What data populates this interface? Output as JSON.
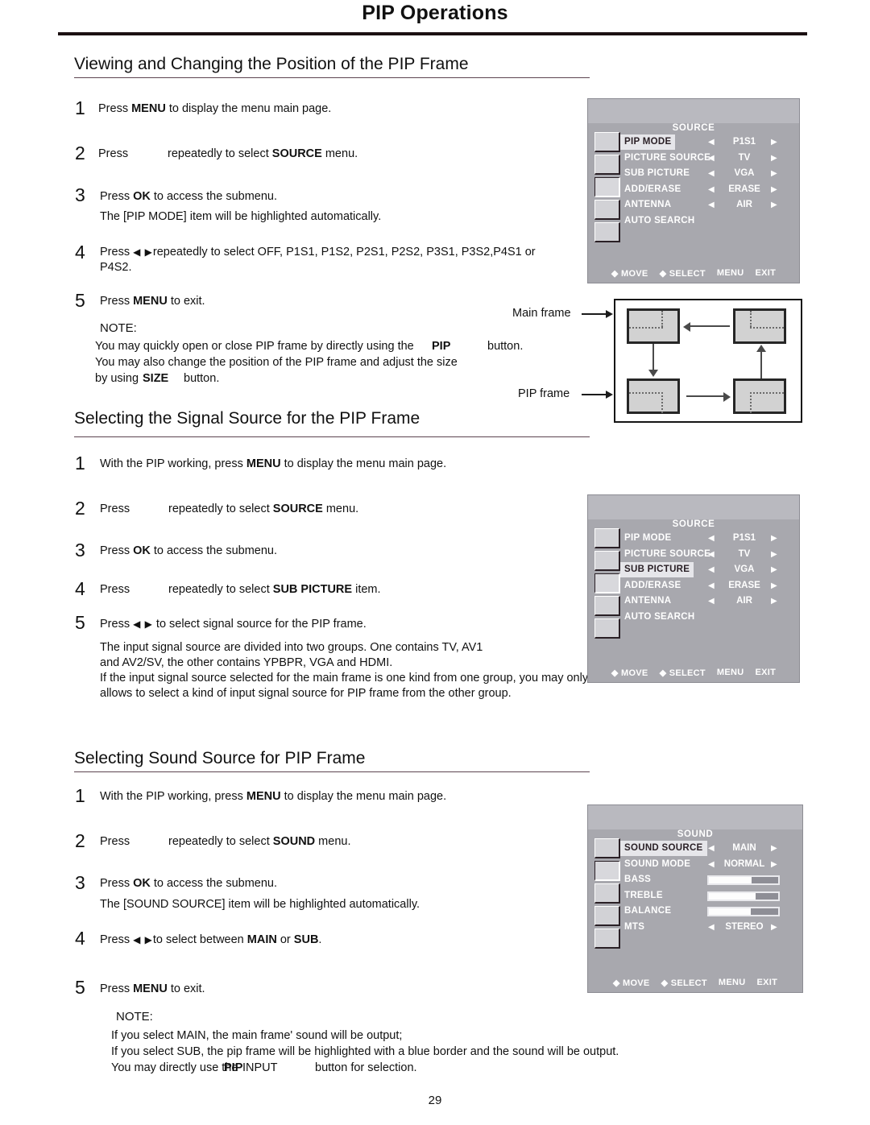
{
  "document": {
    "title": "PIP Operations",
    "page_number": "29"
  },
  "sections": [
    {
      "heading": "Viewing and Changing the Position of the PIP Frame",
      "steps": [
        {
          "n": "1",
          "text_before": "Press ",
          "bold": "MENU",
          "text_after": " to display the menu main page."
        },
        {
          "n": "2",
          "text_before": "Press ",
          "bold": "",
          "text_after": "repeatedly to select ",
          "bold2": "SOURCE",
          "tail": " menu."
        },
        {
          "n": "3",
          "text_before": "Press ",
          "bold": "OK",
          "text_after": " to access the submenu.",
          "sub": "The [PIP MODE] item will be highlighted automatically."
        },
        {
          "n": "4",
          "text_before": "Press ",
          "glyph": "◀ ▶",
          "text_after": "repeatedly to select OFF, P1S1, P1S2, P2S1, P2S2, P3S1, P3S2,P4S1 or",
          "line2": "P4S2."
        },
        {
          "n": "5",
          "text_before": "Press ",
          "bold": "MENU",
          "text_after": " to exit."
        }
      ],
      "note_label": "NOTE:",
      "note_lines": [
        "You may quickly open or close PIP frame by directly using the",
        "PIP",
        "button.",
        "You may also change the position of the PIP frame and adjust the size",
        "by using",
        "SIZE",
        "button."
      ]
    },
    {
      "heading": "Selecting the Signal Source for the PIP Frame",
      "steps": [
        {
          "n": "1",
          "text_before": "With the PIP working, press  ",
          "bold": "MENU",
          "text_after": " to display the menu main page."
        },
        {
          "n": "2",
          "text_before": "Press ",
          "text_after": "repeatedly to select ",
          "bold2": "SOURCE",
          "tail": " menu."
        },
        {
          "n": "3",
          "text_before": "Press ",
          "bold": "OK",
          "text_after": " to access the submenu."
        },
        {
          "n": "4",
          "text_before": "Press ",
          "text_after": "repeatedly to select ",
          "bold2": "SUB PICTURE",
          "tail": " item."
        },
        {
          "n": "5",
          "text_before": "Press ",
          "glyph": "◀  ▶",
          "text_after": " to select signal source for the PIP frame."
        }
      ],
      "body_lines": [
        "The input signal source are divided into two groups. One contains TV, AV1",
        "and AV2/SV, the other contains YPBPR, VGA and HDMI.",
        "If the input signal source selected for the main frame is one kind from one group, you may only",
        "allows to select  a kind of input signal source for PIP frame from the other group."
      ]
    },
    {
      "heading": "Selecting Sound Source for PIP Frame",
      "steps": [
        {
          "n": "1",
          "text_before": "With the PIP working, press  ",
          "bold": "MENU",
          "text_after": " to display the menu main page."
        },
        {
          "n": "2",
          "text_before": "Press ",
          "text_after": "repeatedly to select ",
          "bold2": "SOUND",
          "tail": " menu."
        },
        {
          "n": "3",
          "text_before": "Press ",
          "bold": "OK",
          "text_after": " to access the submenu.",
          "sub": "The [SOUND SOURCE] item will be highlighted automatically."
        },
        {
          "n": "4",
          "text_before": "Press ",
          "glyph": "◀  ▶",
          "text_after": "to select between ",
          "bold2": "MAIN",
          "mid": " or ",
          "bold3": "SUB",
          "tail": "."
        },
        {
          "n": "5",
          "text_before": "Press ",
          "bold": "MENU",
          "text_after": " to exit."
        }
      ],
      "note_label": "NOTE:",
      "note_lines": [
        "If you select MAIN, the main frame' sound will be output;",
        "If you select SUB, the pip frame will be highlighted with a blue border and the sound will be output.",
        "You may directly use the",
        "PIP",
        "INPUT",
        "button for selection."
      ]
    }
  ],
  "osd_menus": [
    {
      "id": "source-menu-1",
      "title": "SOURCE",
      "active_tab_index": 2,
      "tab_count": 5,
      "rows": [
        {
          "label": "PIP MODE",
          "highlighted": true,
          "left_arrow": "◀",
          "value": "P1S1",
          "right_arrow": "▶"
        },
        {
          "label": "PICTURE SOURCE",
          "highlighted": false,
          "left_arrow": "◀",
          "value": "TV",
          "right_arrow": "▶"
        },
        {
          "label": "SUB PICTURE",
          "highlighted": false,
          "left_arrow": "◀",
          "value": "VGA",
          "right_arrow": "▶"
        },
        {
          "label": "ADD/ERASE",
          "highlighted": false,
          "left_arrow": "◀",
          "value": "ERASE",
          "right_arrow": "▶"
        },
        {
          "label": "ANTENNA",
          "highlighted": false,
          "left_arrow": "◀",
          "value": "AIR",
          "right_arrow": "▶"
        },
        {
          "label": "AUTO SEARCH",
          "highlighted": false,
          "left_arrow": "",
          "value": "",
          "right_arrow": ""
        }
      ],
      "footer": [
        "◆ MOVE",
        "◆ SELECT",
        "MENU",
        "EXIT"
      ]
    },
    {
      "id": "source-menu-2",
      "title": "SOURCE",
      "active_tab_index": 2,
      "tab_count": 5,
      "rows": [
        {
          "label": "PIP MODE",
          "highlighted": false,
          "left_arrow": "◀",
          "value": "P1S1",
          "right_arrow": "▶"
        },
        {
          "label": "PICTURE SOURCE",
          "highlighted": false,
          "left_arrow": "◀",
          "value": "TV",
          "right_arrow": "▶"
        },
        {
          "label": "SUB PICTURE",
          "highlighted": true,
          "left_arrow": "◀",
          "value": "VGA",
          "right_arrow": "▶"
        },
        {
          "label": "ADD/ERASE",
          "highlighted": false,
          "left_arrow": "◀",
          "value": "ERASE",
          "right_arrow": "▶"
        },
        {
          "label": "ANTENNA",
          "highlighted": false,
          "left_arrow": "◀",
          "value": "AIR",
          "right_arrow": "▶"
        },
        {
          "label": "AUTO SEARCH",
          "highlighted": false,
          "left_arrow": "",
          "value": "",
          "right_arrow": ""
        }
      ],
      "footer": [
        "◆ MOVE",
        "◆ SELECT",
        "MENU",
        "EXIT"
      ]
    },
    {
      "id": "sound-menu",
      "title": "SOUND",
      "active_tab_index": 1,
      "tab_count": 5,
      "rows": [
        {
          "label": "SOUND SOURCE",
          "highlighted": true,
          "left_arrow": "◀",
          "value": "MAIN",
          "right_arrow": "▶"
        },
        {
          "label": "SOUND MODE",
          "highlighted": false,
          "left_arrow": "◀",
          "value": "NORMAL",
          "right_arrow": "▶"
        },
        {
          "label": "BASS",
          "highlighted": false,
          "bar": 62
        },
        {
          "label": "TREBLE",
          "highlighted": false,
          "bar": 68
        },
        {
          "label": "BALANCE",
          "highlighted": false,
          "bar": 60
        },
        {
          "label": "MTS",
          "highlighted": false,
          "left_arrow": "◀",
          "value": "STEREO",
          "right_arrow": "▶"
        }
      ],
      "footer": [
        "◆ MOVE",
        "◆ SELECT",
        "MENU",
        "EXIT"
      ]
    }
  ],
  "pip_diagram": {
    "main_frame_label": "Main frame",
    "pip_frame_label": "PIP frame",
    "frames": [
      {
        "position": "top-left-of-grid",
        "pip_corner": "top-right"
      },
      {
        "position": "top-right-of-grid",
        "pip_corner": "top-left"
      },
      {
        "position": "bottom-left-of-grid",
        "pip_corner": "top-left-block"
      },
      {
        "position": "bottom-right-of-grid",
        "pip_corner": "top-right-block"
      }
    ]
  }
}
